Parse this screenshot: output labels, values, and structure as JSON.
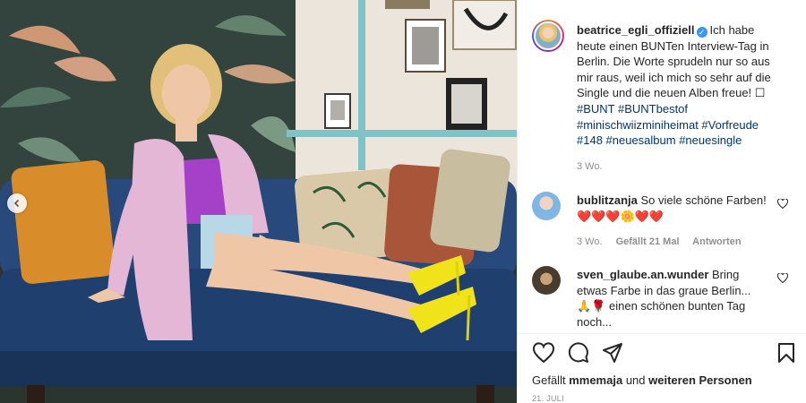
{
  "post": {
    "username": "beatrice_egli_offiziell",
    "caption": "Ich habe heute einen BUNTen Interview-Tag in Berlin. Die Worte sprudeln nur so aus mir raus, weil ich mich so sehr auf die Single und die neuen Alben freue! ☐",
    "hashtags": "#BUNT #BUNTbestof #minischwiizminiheimat #Vorfreude #148 #neuesalbum #neuesingle",
    "time": "3 Wo."
  },
  "comments": [
    {
      "username": "bublitzanja",
      "text": "So viele schöne Farben!",
      "emojis": "❤️❤️❤️🌼❤️❤️",
      "time": "3 Wo.",
      "likes": "Gefällt 21 Mal",
      "reply": "Antworten"
    },
    {
      "username": "sven_glaube.an.wunder",
      "text": "Bring etwas Farbe in das graue Berlin...",
      "text2": "🙏🌹 einen schönen bunten Tag noch..."
    }
  ],
  "likes": {
    "prefix": "Gefällt",
    "user": "mmemaja",
    "middle": "und",
    "others": "weiteren Personen"
  },
  "date": "21. JULI",
  "icons": {
    "like": "heart-icon",
    "comment": "comment-icon",
    "share": "share-icon",
    "save": "bookmark-icon",
    "prev": "chevron-left-icon"
  },
  "colors": {
    "link": "#00376b",
    "verified": "#3897f0",
    "muted": "#8e8e8e"
  }
}
